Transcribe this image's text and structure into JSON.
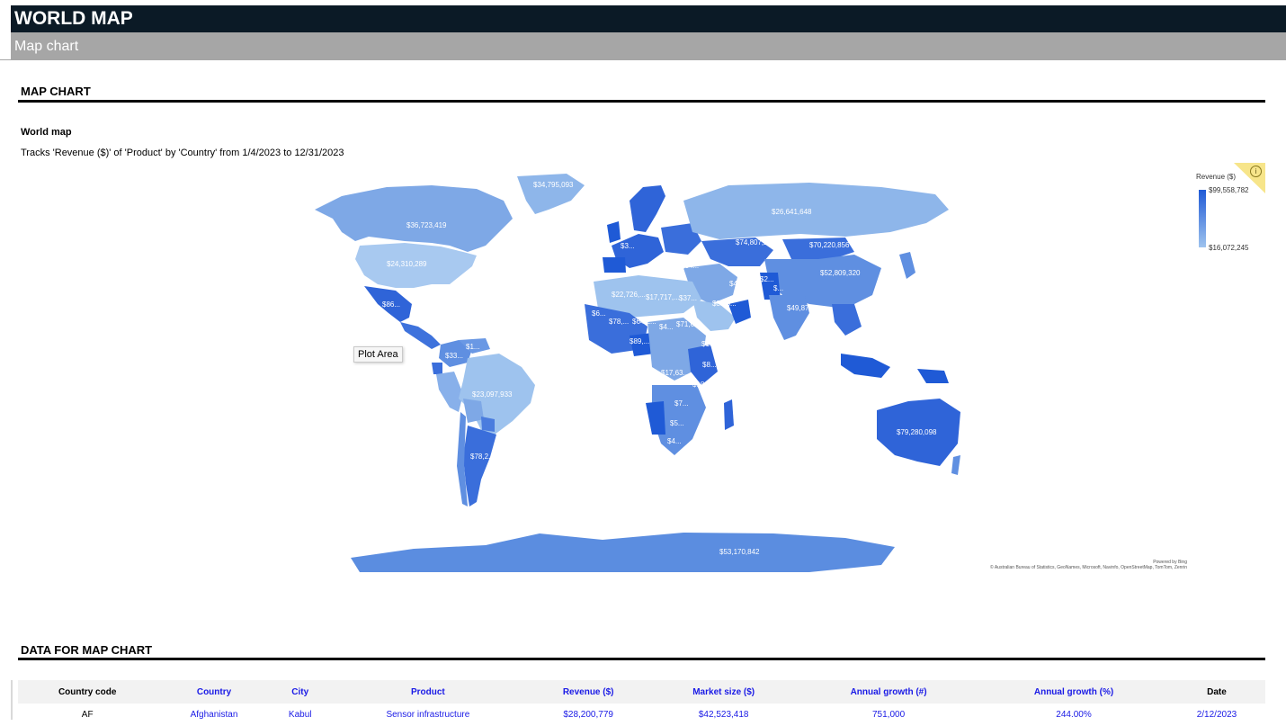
{
  "header": {
    "title": "WORLD MAP",
    "subtitle": "Map chart"
  },
  "section_map": {
    "heading": "MAP CHART",
    "chart_name": "World map",
    "description": "Tracks 'Revenue ($)' of 'Product' by 'Country' from 1/4/2023 to 12/31/2023"
  },
  "tooltip": "Plot Area",
  "legend": {
    "title": "Revenue ($)",
    "max": "$99,558,782",
    "min": "$16,072,245",
    "info_icon": "info-icon"
  },
  "credits": {
    "line1": "Powered by Bing",
    "line2": "© Australian Bureau of Statistics, GeoNames, Microsoft, Navinfo, OpenStreetMap, TomTom, Zenrin"
  },
  "colors": {
    "high": "#1f5ad6",
    "mid": "#5b8de0",
    "low": "#9ec3ee",
    "title_bar": "#0b1a26",
    "sub_bar": "#a6a6a6"
  },
  "chart_data": {
    "type": "map",
    "title": "World map",
    "measure": "Revenue ($)",
    "color_scale": {
      "min": 16072245,
      "max": 99558782
    },
    "labels": [
      "$34,795,093",
      "$36,723,419",
      "$26,641,648",
      "$24,310,289",
      "$74,807,288",
      "$70,220,856",
      "$52,809,320",
      "$44,04...",
      "$40,8...",
      "$2...",
      "$3...",
      "$37...",
      "$31,5...",
      "$49,872...",
      "$22,726,...",
      "$17,717,...",
      "$6...",
      "$78,...",
      "$64,2...",
      "$4...",
      "$71,61...",
      "$89,...",
      "$16...",
      "$17,63...",
      "$8...",
      "$18...",
      "$67...",
      "$7...",
      "$5...",
      "$4...",
      "$86...",
      "$33...",
      "$1...",
      "$23,097,933",
      "$78,2...",
      "$79,280,098",
      "$53,170,842",
      "$..."
    ]
  },
  "section_data": {
    "heading": "DATA FOR MAP CHART",
    "columns": [
      "Country code",
      "Country",
      "City",
      "Product",
      "Revenue ($)",
      "Market size ($)",
      "Annual growth (#)",
      "Annual growth (%)",
      "Date"
    ],
    "rows": [
      [
        "AF",
        "Afghanistan",
        "Kabul",
        "Sensor infrastructure",
        "$28,200,779",
        "$42,523,418",
        "751,000",
        "244.00%",
        "2/12/2023"
      ]
    ]
  }
}
